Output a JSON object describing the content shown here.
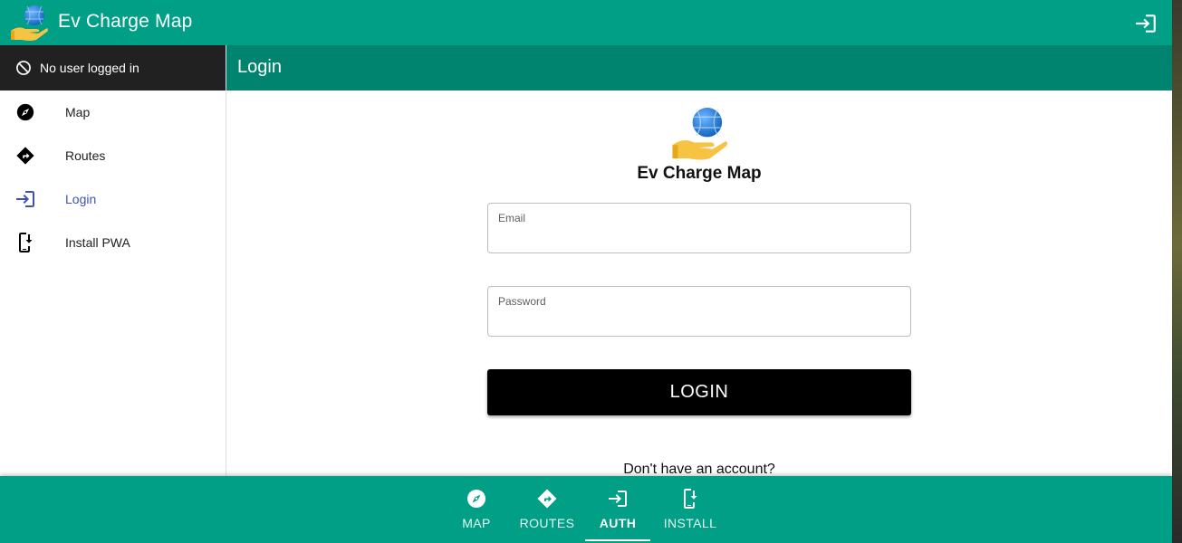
{
  "app": {
    "title": "Ev Charge Map"
  },
  "topbar": {
    "action_icon": "login-icon"
  },
  "sidebar": {
    "user_status": "No user logged in",
    "items": [
      {
        "label": "Map",
        "icon": "compass-icon"
      },
      {
        "label": "Routes",
        "icon": "directions-icon"
      },
      {
        "label": "Login",
        "icon": "login-icon",
        "active": true
      },
      {
        "label": "Install PWA",
        "icon": "install-mobile-icon"
      }
    ]
  },
  "page": {
    "title": "Login"
  },
  "login": {
    "brand": "Ev Charge Map",
    "email_label": "Email",
    "email_value": "",
    "password_label": "Password",
    "password_value": "",
    "submit_label": "LOGIN",
    "signup_prompt": "Don't have an account?"
  },
  "bottomnav": {
    "items": [
      {
        "label": "MAP",
        "icon": "compass-icon"
      },
      {
        "label": "ROUTES",
        "icon": "directions-icon"
      },
      {
        "label": "AUTH",
        "icon": "login-icon",
        "active": true
      },
      {
        "label": "INSTALL",
        "icon": "install-mobile-icon"
      }
    ]
  },
  "colors": {
    "primary": "#009f86",
    "primary_dark": "#00846f",
    "user_bar": "#212121",
    "active_nav": "#3f51b5",
    "button": "#000000"
  }
}
